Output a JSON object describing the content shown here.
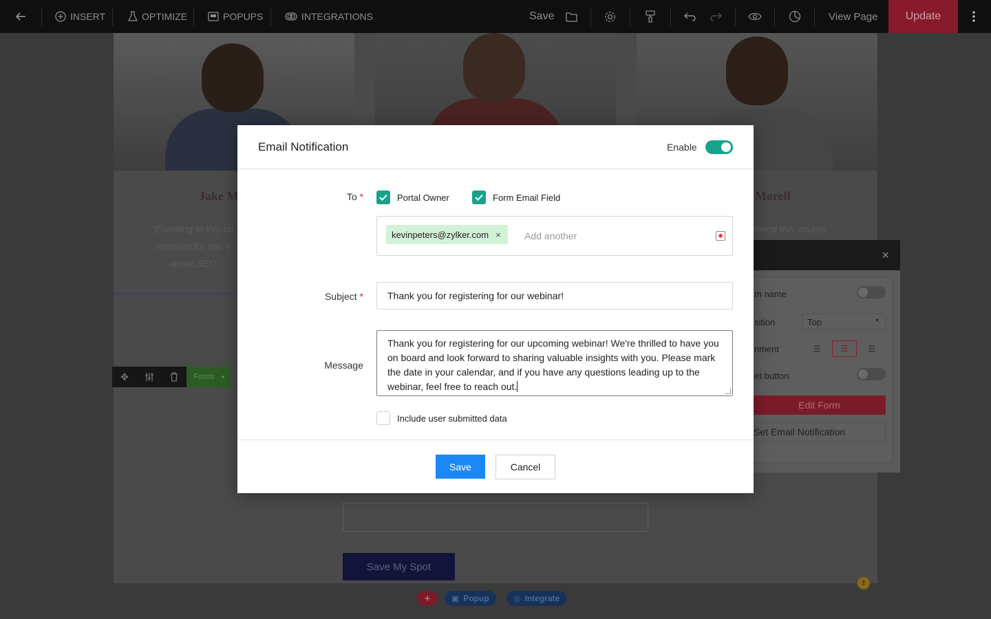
{
  "toolbar": {
    "insert_label": "INSERT",
    "optimize_label": "OPTIMIZE",
    "popups_label": "POPUPS",
    "integrations_label": "INTEGRATIONS",
    "save_label": "Save",
    "view_page_label": "View Page",
    "update_label": "Update"
  },
  "background": {
    "testimonial_1_name": "Jake M",
    "testimonial_1_quote": "\"Enrolling in this co\nmoment for me. I\nabout SEO",
    "testimonial_3_name": "Morell",
    "testimonial_3_quote": "mend this course",
    "editbar_forms_label": "Forms",
    "save_spot_label": "Save My Spot",
    "popup_pill_label": "Popup",
    "integrate_pill_label": "Integrate",
    "plus_label": "+"
  },
  "side_panel": {
    "close_label": "×",
    "form_name_label": "m name",
    "position_label": "sition",
    "position_value": "Top",
    "alignment_label": "nment",
    "reset_button_label": "et button",
    "edit_form_label": "Edit Form",
    "set_notification_label": "Set Email Notification"
  },
  "modal": {
    "title": "Email Notification",
    "enable_label": "Enable",
    "enabled": true,
    "to_label": "To",
    "required_mark": "*",
    "portal_owner_label": "Portal Owner",
    "portal_owner_checked": true,
    "form_email_field_label": "Form Email Field",
    "form_email_field_checked": true,
    "recipient_email": "kevinpeters@zylker.com",
    "remove_label": "×",
    "add_another_placeholder": "Add another",
    "subject_label": "Subject",
    "subject_value": "Thank you for registering for our webinar!",
    "message_label": "Message",
    "message_value": "Thank you for registering for our upcoming webinar! We're thrilled to have you on board and look forward to sharing valuable insights with you. Please mark the date in your calendar, and if you have any questions leading up to the webinar, feel free to reach out.",
    "include_data_label": "Include user submitted data",
    "include_data_checked": false,
    "save_label": "Save",
    "cancel_label": "Cancel"
  },
  "colors": {
    "accent_teal": "#17a38b",
    "primary_blue": "#1b88f5",
    "update_red": "#861a2a",
    "chip_green": "#d2f2d8"
  }
}
